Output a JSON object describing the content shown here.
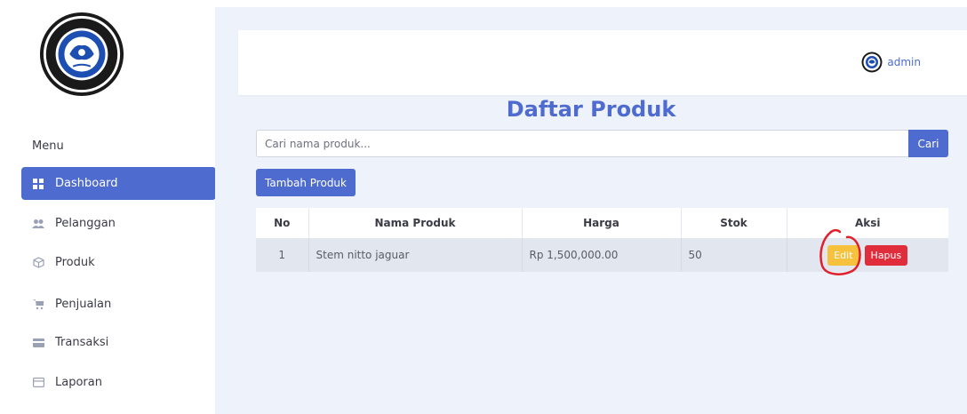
{
  "sidebar": {
    "menu_heading": "Menu",
    "items": [
      {
        "label": "Dashboard",
        "icon": "grid-icon",
        "active": true
      },
      {
        "label": "Pelanggan",
        "icon": "users-icon",
        "active": false
      },
      {
        "label": "Produk",
        "icon": "box-icon",
        "active": false
      },
      {
        "label": "Penjualan",
        "icon": "cart-icon",
        "active": false
      },
      {
        "label": "Transaksi",
        "icon": "credit-card-icon",
        "active": false
      },
      {
        "label": "Laporan",
        "icon": "report-icon",
        "active": false
      }
    ]
  },
  "topbar": {
    "username": "admin"
  },
  "page": {
    "title": "Daftar Produk"
  },
  "search": {
    "placeholder": "Cari nama produk...",
    "value": "",
    "button_label": "Cari"
  },
  "actions": {
    "add_label": "Tambah Produk"
  },
  "table": {
    "headers": [
      "No",
      "Nama Produk",
      "Harga",
      "Stok",
      "Aksi"
    ],
    "rows": [
      {
        "no": "1",
        "nama": "Stem nitto jaguar",
        "harga": "Rp 1,500,000.00",
        "stok": "50",
        "edit_label": "Edit",
        "hapus_label": "Hapus"
      }
    ]
  },
  "colors": {
    "primary": "#4e6bd0",
    "warning": "#f6c23e",
    "danger": "#e02d3c",
    "background": "#eef2fa",
    "annotation": "#e0202a"
  }
}
